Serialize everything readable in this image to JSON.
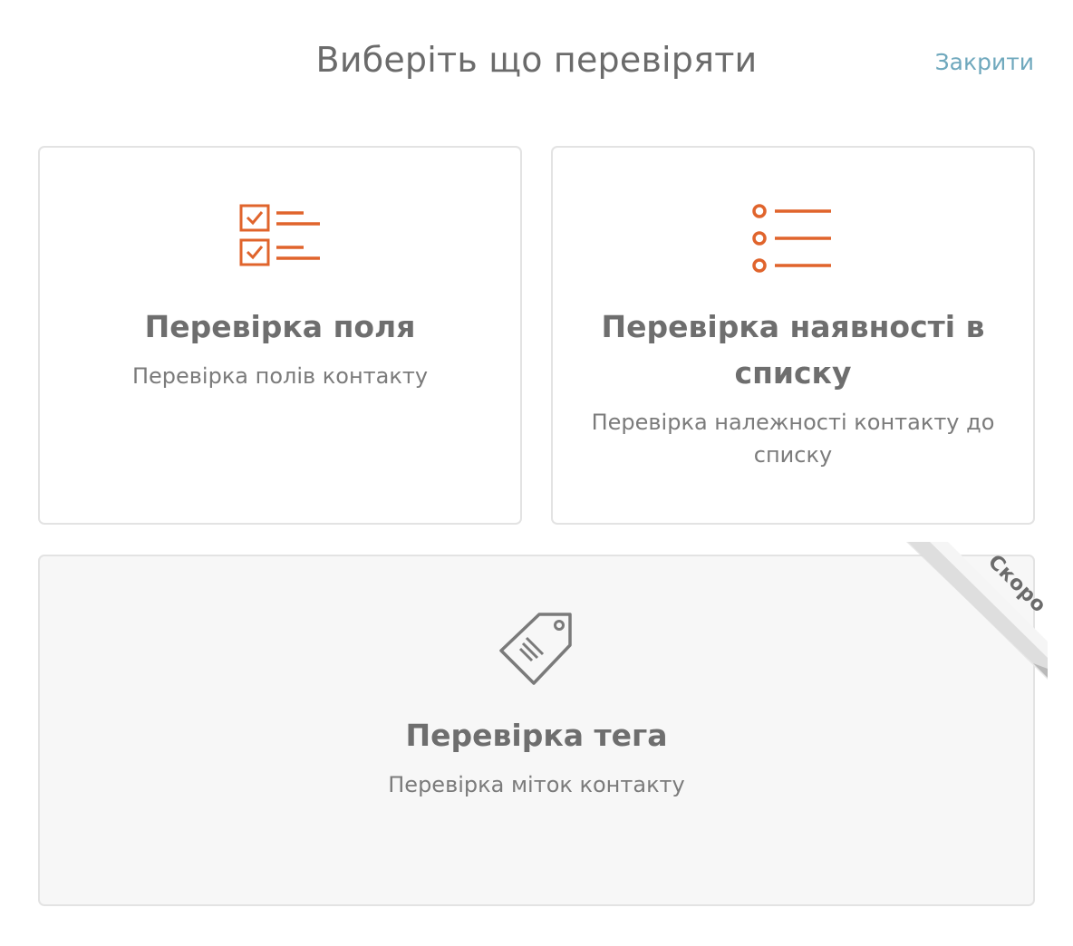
{
  "header": {
    "title": "Виберіть що перевіряти",
    "close_label": "Закрити"
  },
  "cards": [
    {
      "icon": "checklist-icon",
      "title": "Перевірка поля",
      "description": "Перевірка полів контакту",
      "enabled": true
    },
    {
      "icon": "bullet-list-icon",
      "title": "Перевірка наявності в списку",
      "description": "Перевірка належності контакту до списку",
      "enabled": true
    },
    {
      "icon": "tag-icon",
      "title": "Перевірка тега",
      "description": "Перевірка міток контакту",
      "enabled": false,
      "badge": "Скоро"
    }
  ],
  "colors": {
    "accent": "#e0642c",
    "link": "#6fa8bd",
    "disabled_icon": "#7a7a7a"
  }
}
